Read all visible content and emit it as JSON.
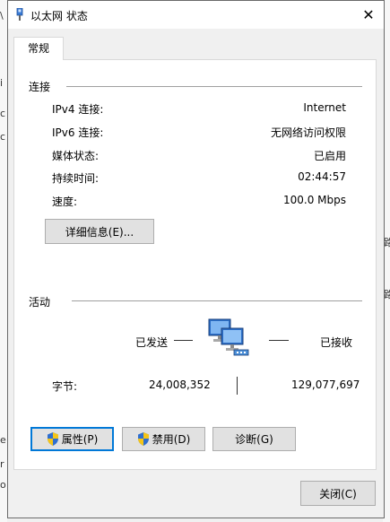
{
  "window": {
    "title": "以太网 状态",
    "close_glyph": "✕"
  },
  "tabs": [
    {
      "label": "常规"
    }
  ],
  "connection": {
    "heading": "连接",
    "rows": [
      {
        "label": "IPv4 连接:",
        "value": "Internet"
      },
      {
        "label": "IPv6 连接:",
        "value": "无网络访问权限"
      },
      {
        "label": "媒体状态:",
        "value": "已启用"
      },
      {
        "label": "持续时间:",
        "value": "02:44:57"
      },
      {
        "label": "速度:",
        "value": "100.0 Mbps"
      }
    ],
    "details_button": "详细信息(E)..."
  },
  "activity": {
    "heading": "活动",
    "sent_label": "已发送",
    "received_label": "已接收",
    "bytes_label": "字节:",
    "bytes_sent": "24,008,352",
    "bytes_received": "129,077,697"
  },
  "buttons": {
    "properties": "属性(P)",
    "disable": "禁用(D)",
    "diagnose": "诊断(G)",
    "close": "关闭(C)"
  },
  "colors": {
    "accent": "#0078d7",
    "button_face": "#e1e1e1",
    "shield_blue": "#2f6fcf",
    "shield_yellow": "#f5c518"
  }
}
